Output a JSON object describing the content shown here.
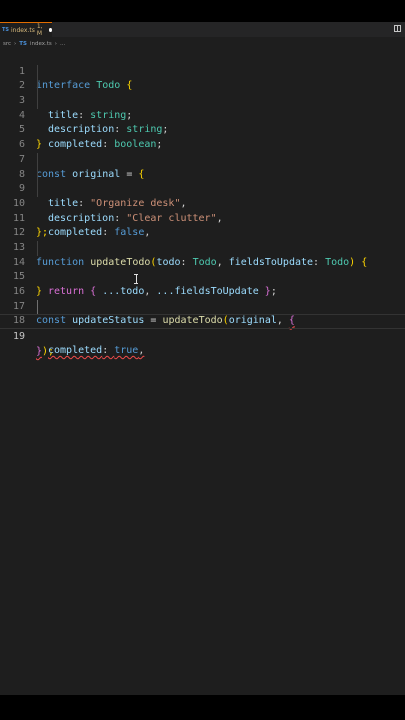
{
  "tab": {
    "lang_badge": "TS",
    "filename": "index.ts",
    "status": "1, M"
  },
  "breadcrumb": [
    "src",
    "TS",
    "index.ts",
    "..."
  ],
  "lines": [
    {
      "n": "1"
    },
    {
      "n": "2"
    },
    {
      "n": "3"
    },
    {
      "n": "4"
    },
    {
      "n": "5"
    },
    {
      "n": "6"
    },
    {
      "n": "7"
    },
    {
      "n": "8"
    },
    {
      "n": "9"
    },
    {
      "n": "10"
    },
    {
      "n": "11"
    },
    {
      "n": "12"
    },
    {
      "n": "13"
    },
    {
      "n": "14"
    },
    {
      "n": "15"
    },
    {
      "n": "16"
    },
    {
      "n": "17"
    },
    {
      "n": "18"
    },
    {
      "n": "19"
    }
  ],
  "code": {
    "l1": [
      "interface",
      "Todo",
      "{"
    ],
    "l2": [
      "title",
      ": ",
      "string",
      ";"
    ],
    "l3": [
      "description",
      ": ",
      "string",
      ";"
    ],
    "l4": [
      "completed",
      ": ",
      "boolean",
      ";"
    ],
    "l5": [
      "}"
    ],
    "l7": [
      "const",
      "original",
      " = ",
      "{"
    ],
    "l8": [
      "title",
      ": ",
      "\"Organize desk\"",
      ","
    ],
    "l9": [
      "description",
      ": ",
      "\"Clear clutter\"",
      ","
    ],
    "l10": [
      "completed",
      ": ",
      "false",
      ","
    ],
    "l11": [
      "};"
    ],
    "l13": [
      "function",
      "updateTodo",
      "(",
      "todo",
      ": ",
      "Todo",
      ", ",
      "fieldsToUpdate",
      ": ",
      "Todo",
      ") ",
      "{"
    ],
    "l14": [
      "return",
      "{ ",
      "...todo",
      ", ",
      "...fieldsToUpdate",
      " }",
      ";"
    ],
    "l15": [
      "}"
    ],
    "l17": [
      "const",
      "updateStatus",
      " = ",
      "updateTodo",
      "(",
      "original",
      ", ",
      "{"
    ],
    "l18": [
      "completed",
      ": ",
      "true",
      ","
    ],
    "l19": [
      "}",
      ");"
    ]
  },
  "colors": {
    "background": "#1e1e1e",
    "keyword": "#569cd6",
    "type": "#4ec9b0",
    "property": "#9cdcfe",
    "string": "#ce9178",
    "function": "#dcdcaa",
    "error_underline": "#f14c4c"
  },
  "icons": {
    "split_editor": "split-editor-icon",
    "mouse_cursor": "text-cursor-icon"
  }
}
